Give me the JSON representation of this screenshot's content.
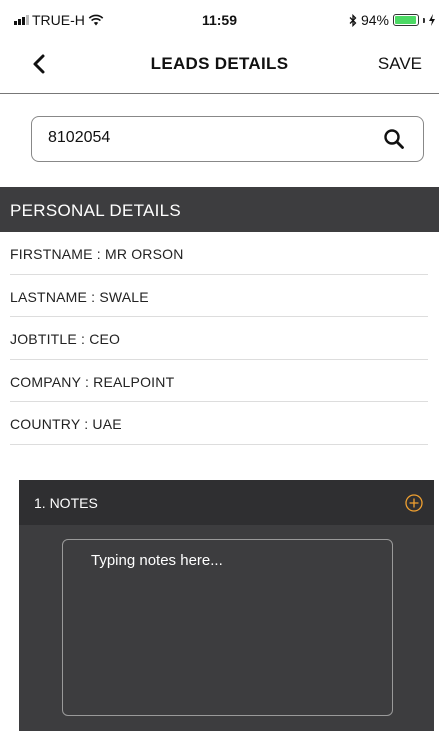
{
  "status_bar": {
    "carrier": "TRUE-H",
    "time": "11:59",
    "battery_percent": "94%",
    "battery_level": 0.94
  },
  "nav": {
    "title": "LEADS DETAILS",
    "save_label": "SAVE"
  },
  "search": {
    "value": "8102054"
  },
  "personal_details": {
    "header": "PERSONAL DETAILS",
    "rows": [
      "FIRSTNAME : MR ORSON",
      "LASTNAME :  SWALE",
      "JOBTITLE :  CEO",
      "COMPANY :  REALPOINT",
      "COUNTRY :  UAE"
    ]
  },
  "notes": {
    "title": "1. NOTES",
    "placeholder": "Typing notes here..."
  },
  "colors": {
    "header_bg": "#3d3d3f",
    "notes_header_bg": "#2f2f31",
    "accent": "#f0a030",
    "battery": "#4cd964"
  }
}
